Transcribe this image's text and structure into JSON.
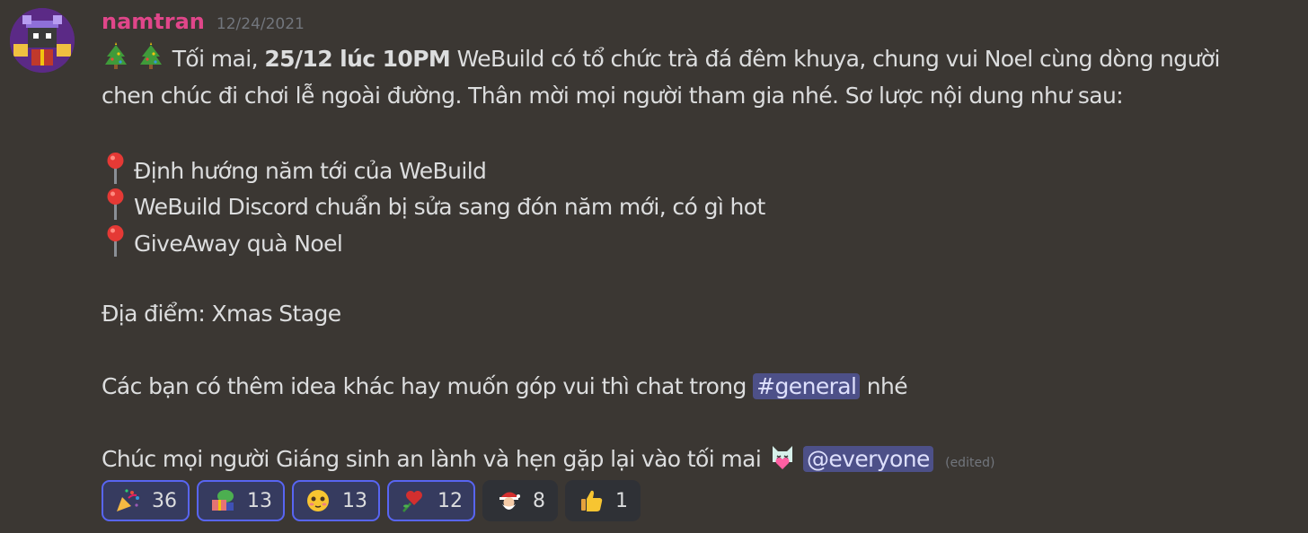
{
  "message": {
    "username": "namtran",
    "timestamp": "12/24/2021",
    "line1_pre": "Tối mai,",
    "line1_bold": "25/12 lúc 10PM",
    "line1_post": "WeBuild có tổ chức trà đá đêm khuya, chung vui Noel cùng dòng người",
    "line2": "chen chúc đi chơi lễ ngoài đường. Thân mời mọi người tham gia nhé. Sơ lược nội dung như sau:",
    "bullets": [
      "Định hướng năm tới của WeBuild",
      "WeBuild Discord chuẩn bị sửa sang đón năm mới, có gì hot",
      "GiveAway quà Noel"
    ],
    "location": "Địa điểm: Xmas Stage",
    "channel_pre": "Các bạn có thêm idea khác hay muốn góp vui thì chat trong",
    "channel_mention": "#general",
    "channel_post": "nhé",
    "closing": "Chúc mọi người Giáng sinh an lành và hẹn gặp lại vào tối mai",
    "everyone_mention": "@everyone",
    "edited": "(edited)"
  },
  "reactions": [
    {
      "icon": "party-popper-icon",
      "count": "36",
      "me": true
    },
    {
      "icon": "pepe-gift-icon",
      "count": "13",
      "me": true
    },
    {
      "icon": "blushing-face-icon",
      "count": "13",
      "me": true
    },
    {
      "icon": "rose-heart-icon",
      "count": "12",
      "me": true
    },
    {
      "icon": "santa-icon",
      "count": "8",
      "me": false
    },
    {
      "icon": "thumbs-up-icon",
      "count": "1",
      "me": false
    }
  ],
  "colors": {
    "background": "#3b3733",
    "username": "#e0468a",
    "mention_bg": "#4d5088",
    "reaction_selected_border": "#5865f2"
  }
}
